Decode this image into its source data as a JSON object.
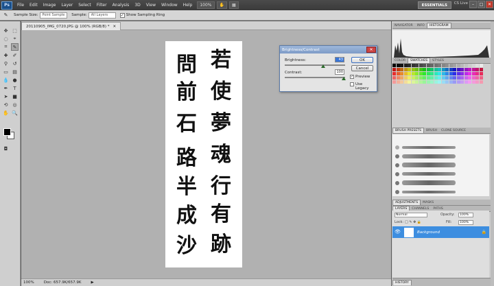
{
  "menubar": {
    "logo": "Ps",
    "items": [
      "File",
      "Edit",
      "Image",
      "Layer",
      "Select",
      "Filter",
      "Analysis",
      "3D",
      "View",
      "Window",
      "Help"
    ],
    "zoom": "100%",
    "workspace": "ESSENTIALS",
    "cs_live": "CS Live"
  },
  "options": {
    "sample_size_label": "Sample Size:",
    "sample_size_value": "Point Sample",
    "sample_label": "Sample:",
    "sample_value": "All Layers",
    "show_ring_label": "Show Sampling Ring"
  },
  "document": {
    "tab_title": "20110905_IMG_0720.JPG @ 100% (RGB/8) *",
    "status_zoom": "100%",
    "status_doc": "Doc: 657.9K/657.9K",
    "columns_right": [
      "若",
      "使",
      "夢",
      "魂",
      "行",
      "有",
      "跡"
    ],
    "columns_left": [
      "問",
      "前",
      "石",
      "路",
      "半",
      "成",
      "沙"
    ]
  },
  "dialog": {
    "title": "Brightness/Contrast",
    "brightness_label": "Brightness:",
    "brightness_value": "43",
    "contrast_label": "Contrast:",
    "contrast_value": "100",
    "ok": "OK",
    "cancel": "Cancel",
    "preview": "Preview",
    "legacy": "Use Legacy"
  },
  "panels": {
    "top_tabs": [
      "NAVIGATOR",
      "INFO",
      "HISTOGRAM"
    ],
    "swatch_tabs": [
      "COLOR",
      "SWATCHES",
      "STYLES"
    ],
    "brush_tabs": [
      "BRUSH PRESETS",
      "BRUSH",
      "CLONE SOURCE"
    ],
    "adjust_tabs": [
      "ADJUSTMENTS",
      "MASKS"
    ],
    "layer_tabs": [
      "LAYERS",
      "CHANNELS",
      "PATHS"
    ],
    "blend_mode": "Normal",
    "opacity_label": "Opacity:",
    "opacity_value": "100%",
    "lock_label": "Lock:",
    "fill_label": "Fill:",
    "fill_value": "100%",
    "layer_name": "Background",
    "history_tab": "HISTORY"
  }
}
